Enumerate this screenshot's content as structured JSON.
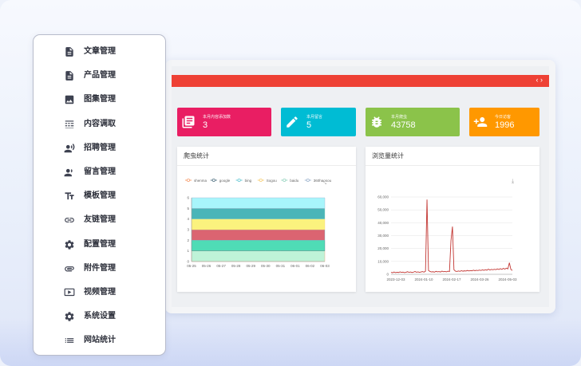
{
  "sidebar": {
    "items": [
      {
        "label": "文章管理",
        "icon": "document-icon"
      },
      {
        "label": "产品管理",
        "icon": "document-icon"
      },
      {
        "label": "图集管理",
        "icon": "image-icon"
      },
      {
        "label": "内容调取",
        "icon": "content-call-icon"
      },
      {
        "label": "招聘管理",
        "icon": "recruit-icon"
      },
      {
        "label": "留言管理",
        "icon": "message-icon"
      },
      {
        "label": "模板管理",
        "icon": "text-template-icon"
      },
      {
        "label": "友链管理",
        "icon": "link-icon"
      },
      {
        "label": "配置管理",
        "icon": "gear-icon"
      },
      {
        "label": "附件管理",
        "icon": "attachment-icon"
      },
      {
        "label": "视频管理",
        "icon": "video-icon"
      },
      {
        "label": "系统设置",
        "icon": "gear-icon"
      },
      {
        "label": "网站统计",
        "icon": "list-icon"
      }
    ]
  },
  "stats": [
    {
      "label": "本月内容添加数",
      "value": "3",
      "color": "#e91e63",
      "icon": "content-icon"
    },
    {
      "label": "本月留言",
      "value": "5",
      "color": "#00bcd4",
      "icon": "edit-icon"
    },
    {
      "label": "本月爬虫",
      "value": "43758",
      "color": "#8bc34a",
      "icon": "bug-icon"
    },
    {
      "label": "今日访客",
      "value": "1996",
      "color": "#ff9800",
      "icon": "add-user-icon"
    }
  ],
  "colors": {
    "topbar": "#ee4135",
    "crawler_bands": [
      "#a8f5fb",
      "#4ab5b8",
      "#fbf27e",
      "#db6471",
      "#4fdcb6",
      "#bff3d8"
    ],
    "traffic_line": "#c23531"
  },
  "crawler_chart": {
    "title": "爬虫统计",
    "legend": [
      {
        "name": "shenma",
        "color": "#f7a072"
      },
      {
        "name": "google",
        "color": "#5b7a8a"
      },
      {
        "name": "bing",
        "color": "#6ccad6"
      },
      {
        "name": "Sogou",
        "color": "#f7d07a"
      },
      {
        "name": "baidu",
        "color": "#9ad6c2"
      },
      {
        "name": "360haosou",
        "color": "#a0b6d0"
      }
    ]
  },
  "traffic_chart": {
    "title": "浏览量统计",
    "download_icon": "download-icon"
  },
  "chart_data": [
    {
      "type": "area",
      "title": "爬虫统计",
      "categories": [
        "05-25",
        "05-26",
        "05-27",
        "05-28",
        "05-29",
        "05-30",
        "05-31",
        "06-01",
        "06-02",
        "06-03"
      ],
      "yticks": [
        "0",
        "1",
        "2",
        "3",
        "4",
        "5",
        "6"
      ],
      "ylim": [
        0,
        6
      ],
      "series": [
        {
          "name": "shenma",
          "values": [
            1,
            1,
            1,
            1,
            1,
            1,
            1,
            1,
            1,
            1
          ]
        },
        {
          "name": "google",
          "values": [
            1,
            1,
            1,
            1,
            1,
            1,
            1,
            1,
            1,
            1
          ]
        },
        {
          "name": "bing",
          "values": [
            1,
            1,
            1,
            1,
            1,
            1,
            1,
            1,
            1,
            1
          ]
        },
        {
          "name": "Sogou",
          "values": [
            1,
            1,
            1,
            1,
            1,
            1,
            1,
            1,
            1,
            1
          ]
        },
        {
          "name": "baidu",
          "values": [
            1,
            1,
            1,
            1,
            1,
            1,
            1,
            1,
            1,
            1
          ]
        },
        {
          "name": "360haosou",
          "values": [
            1,
            1,
            1,
            1,
            1,
            1,
            1,
            1,
            1,
            1
          ]
        }
      ],
      "legend_placement": "top"
    },
    {
      "type": "line",
      "title": "浏览量统计",
      "xticks": [
        "2023-12-03",
        "2024-01-10",
        "2024-02-17",
        "2024-03-26",
        "2024-05-03"
      ],
      "yticks": [
        "0",
        "10,000",
        "20,000",
        "30,000",
        "40,000",
        "50,000",
        "60,000"
      ],
      "ylim": [
        0,
        60000
      ],
      "series": [
        {
          "name": "",
          "values": [
            1500,
            1200,
            1800,
            1300,
            1600,
            1400,
            1900,
            1500,
            1700,
            1300,
            1600,
            2000,
            1500,
            1800,
            1400,
            1700,
            2200,
            1600,
            1900,
            1500,
            1800,
            2100,
            1700,
            2400,
            58000,
            3000,
            2200,
            1800,
            2000,
            1700,
            2300,
            1900,
            2100,
            1800,
            2500,
            2000,
            2200,
            1900,
            2400,
            2100,
            26000,
            37000,
            3500,
            2400,
            2200,
            2600,
            2300,
            2800,
            2400,
            2700,
            2500,
            3000,
            2600,
            2900,
            2700,
            3200,
            2800,
            3100,
            2900,
            3300,
            3000,
            3400,
            3100,
            3600,
            3200,
            4000,
            3300,
            3800,
            3500,
            3900,
            3600,
            4200,
            3700,
            4400,
            3800,
            4600,
            4000,
            4800,
            4200,
            9000,
            3800,
            3000
          ]
        }
      ],
      "grid": true
    }
  ]
}
